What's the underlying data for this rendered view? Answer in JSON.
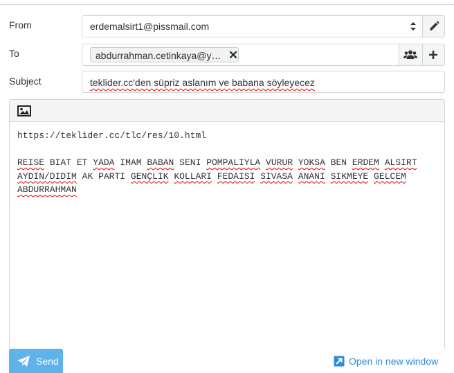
{
  "form": {
    "from_label": "From",
    "from_value": "erdemalsirt1@pissmail.com",
    "to_label": "To",
    "to_recipient": "abdurrahman.cetinkaya@y…",
    "subject_label": "Subject",
    "subject_value": "teklider.cc'den süpriz aslanım ve babana söyleyecez"
  },
  "editor": {
    "url_line": "https://teklider.cc/tlc/res/10.html",
    "body_words_line1": [
      "REISE",
      "BIAT",
      "ET",
      "YADA",
      "IMAM",
      "BABAN",
      "SENI",
      "POMPALIYLA",
      "VURUR",
      "YOKSA",
      "BEN",
      "ERDEM",
      "ALSIRT"
    ],
    "body_words_line2": [
      "AYDIN/DIDIM",
      "AK",
      "PARTI",
      "GENÇLIK",
      "KOLLARI",
      "FEDAISI",
      "SIVASA",
      "ANANI",
      "SIKMEYE",
      "GELCEM"
    ],
    "body_words_line3": [
      "ABDURRAHMAN"
    ]
  },
  "footer": {
    "send_label": "Send",
    "open_window_label": "Open in new window"
  },
  "colors": {
    "accent": "#5eb3eb",
    "link": "#2a8be0",
    "spell_underline": "#e00000"
  },
  "icons": [
    "select-arrows-icon",
    "pencil-icon",
    "remove-icon",
    "contacts-icon",
    "plus-icon",
    "image-icon",
    "paper-plane-icon",
    "external-window-icon"
  ]
}
